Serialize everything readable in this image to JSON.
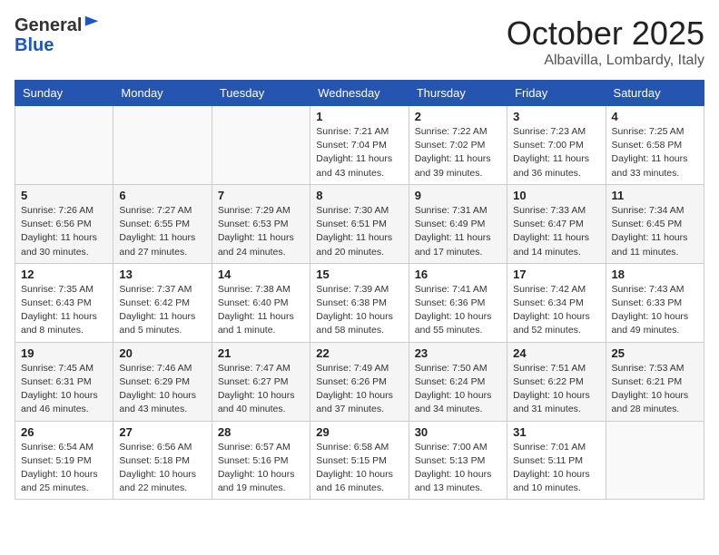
{
  "header": {
    "logo_general": "General",
    "logo_blue": "Blue",
    "month": "October 2025",
    "location": "Albavilla, Lombardy, Italy"
  },
  "weekdays": [
    "Sunday",
    "Monday",
    "Tuesday",
    "Wednesday",
    "Thursday",
    "Friday",
    "Saturday"
  ],
  "weeks": [
    [
      {
        "day": "",
        "info": ""
      },
      {
        "day": "",
        "info": ""
      },
      {
        "day": "",
        "info": ""
      },
      {
        "day": "1",
        "info": "Sunrise: 7:21 AM\nSunset: 7:04 PM\nDaylight: 11 hours\nand 43 minutes."
      },
      {
        "day": "2",
        "info": "Sunrise: 7:22 AM\nSunset: 7:02 PM\nDaylight: 11 hours\nand 39 minutes."
      },
      {
        "day": "3",
        "info": "Sunrise: 7:23 AM\nSunset: 7:00 PM\nDaylight: 11 hours\nand 36 minutes."
      },
      {
        "day": "4",
        "info": "Sunrise: 7:25 AM\nSunset: 6:58 PM\nDaylight: 11 hours\nand 33 minutes."
      }
    ],
    [
      {
        "day": "5",
        "info": "Sunrise: 7:26 AM\nSunset: 6:56 PM\nDaylight: 11 hours\nand 30 minutes."
      },
      {
        "day": "6",
        "info": "Sunrise: 7:27 AM\nSunset: 6:55 PM\nDaylight: 11 hours\nand 27 minutes."
      },
      {
        "day": "7",
        "info": "Sunrise: 7:29 AM\nSunset: 6:53 PM\nDaylight: 11 hours\nand 24 minutes."
      },
      {
        "day": "8",
        "info": "Sunrise: 7:30 AM\nSunset: 6:51 PM\nDaylight: 11 hours\nand 20 minutes."
      },
      {
        "day": "9",
        "info": "Sunrise: 7:31 AM\nSunset: 6:49 PM\nDaylight: 11 hours\nand 17 minutes."
      },
      {
        "day": "10",
        "info": "Sunrise: 7:33 AM\nSunset: 6:47 PM\nDaylight: 11 hours\nand 14 minutes."
      },
      {
        "day": "11",
        "info": "Sunrise: 7:34 AM\nSunset: 6:45 PM\nDaylight: 11 hours\nand 11 minutes."
      }
    ],
    [
      {
        "day": "12",
        "info": "Sunrise: 7:35 AM\nSunset: 6:43 PM\nDaylight: 11 hours\nand 8 minutes."
      },
      {
        "day": "13",
        "info": "Sunrise: 7:37 AM\nSunset: 6:42 PM\nDaylight: 11 hours\nand 5 minutes."
      },
      {
        "day": "14",
        "info": "Sunrise: 7:38 AM\nSunset: 6:40 PM\nDaylight: 11 hours\nand 1 minute."
      },
      {
        "day": "15",
        "info": "Sunrise: 7:39 AM\nSunset: 6:38 PM\nDaylight: 10 hours\nand 58 minutes."
      },
      {
        "day": "16",
        "info": "Sunrise: 7:41 AM\nSunset: 6:36 PM\nDaylight: 10 hours\nand 55 minutes."
      },
      {
        "day": "17",
        "info": "Sunrise: 7:42 AM\nSunset: 6:34 PM\nDaylight: 10 hours\nand 52 minutes."
      },
      {
        "day": "18",
        "info": "Sunrise: 7:43 AM\nSunset: 6:33 PM\nDaylight: 10 hours\nand 49 minutes."
      }
    ],
    [
      {
        "day": "19",
        "info": "Sunrise: 7:45 AM\nSunset: 6:31 PM\nDaylight: 10 hours\nand 46 minutes."
      },
      {
        "day": "20",
        "info": "Sunrise: 7:46 AM\nSunset: 6:29 PM\nDaylight: 10 hours\nand 43 minutes."
      },
      {
        "day": "21",
        "info": "Sunrise: 7:47 AM\nSunset: 6:27 PM\nDaylight: 10 hours\nand 40 minutes."
      },
      {
        "day": "22",
        "info": "Sunrise: 7:49 AM\nSunset: 6:26 PM\nDaylight: 10 hours\nand 37 minutes."
      },
      {
        "day": "23",
        "info": "Sunrise: 7:50 AM\nSunset: 6:24 PM\nDaylight: 10 hours\nand 34 minutes."
      },
      {
        "day": "24",
        "info": "Sunrise: 7:51 AM\nSunset: 6:22 PM\nDaylight: 10 hours\nand 31 minutes."
      },
      {
        "day": "25",
        "info": "Sunrise: 7:53 AM\nSunset: 6:21 PM\nDaylight: 10 hours\nand 28 minutes."
      }
    ],
    [
      {
        "day": "26",
        "info": "Sunrise: 6:54 AM\nSunset: 5:19 PM\nDaylight: 10 hours\nand 25 minutes."
      },
      {
        "day": "27",
        "info": "Sunrise: 6:56 AM\nSunset: 5:18 PM\nDaylight: 10 hours\nand 22 minutes."
      },
      {
        "day": "28",
        "info": "Sunrise: 6:57 AM\nSunset: 5:16 PM\nDaylight: 10 hours\nand 19 minutes."
      },
      {
        "day": "29",
        "info": "Sunrise: 6:58 AM\nSunset: 5:15 PM\nDaylight: 10 hours\nand 16 minutes."
      },
      {
        "day": "30",
        "info": "Sunrise: 7:00 AM\nSunset: 5:13 PM\nDaylight: 10 hours\nand 13 minutes."
      },
      {
        "day": "31",
        "info": "Sunrise: 7:01 AM\nSunset: 5:11 PM\nDaylight: 10 hours\nand 10 minutes."
      },
      {
        "day": "",
        "info": ""
      }
    ]
  ]
}
